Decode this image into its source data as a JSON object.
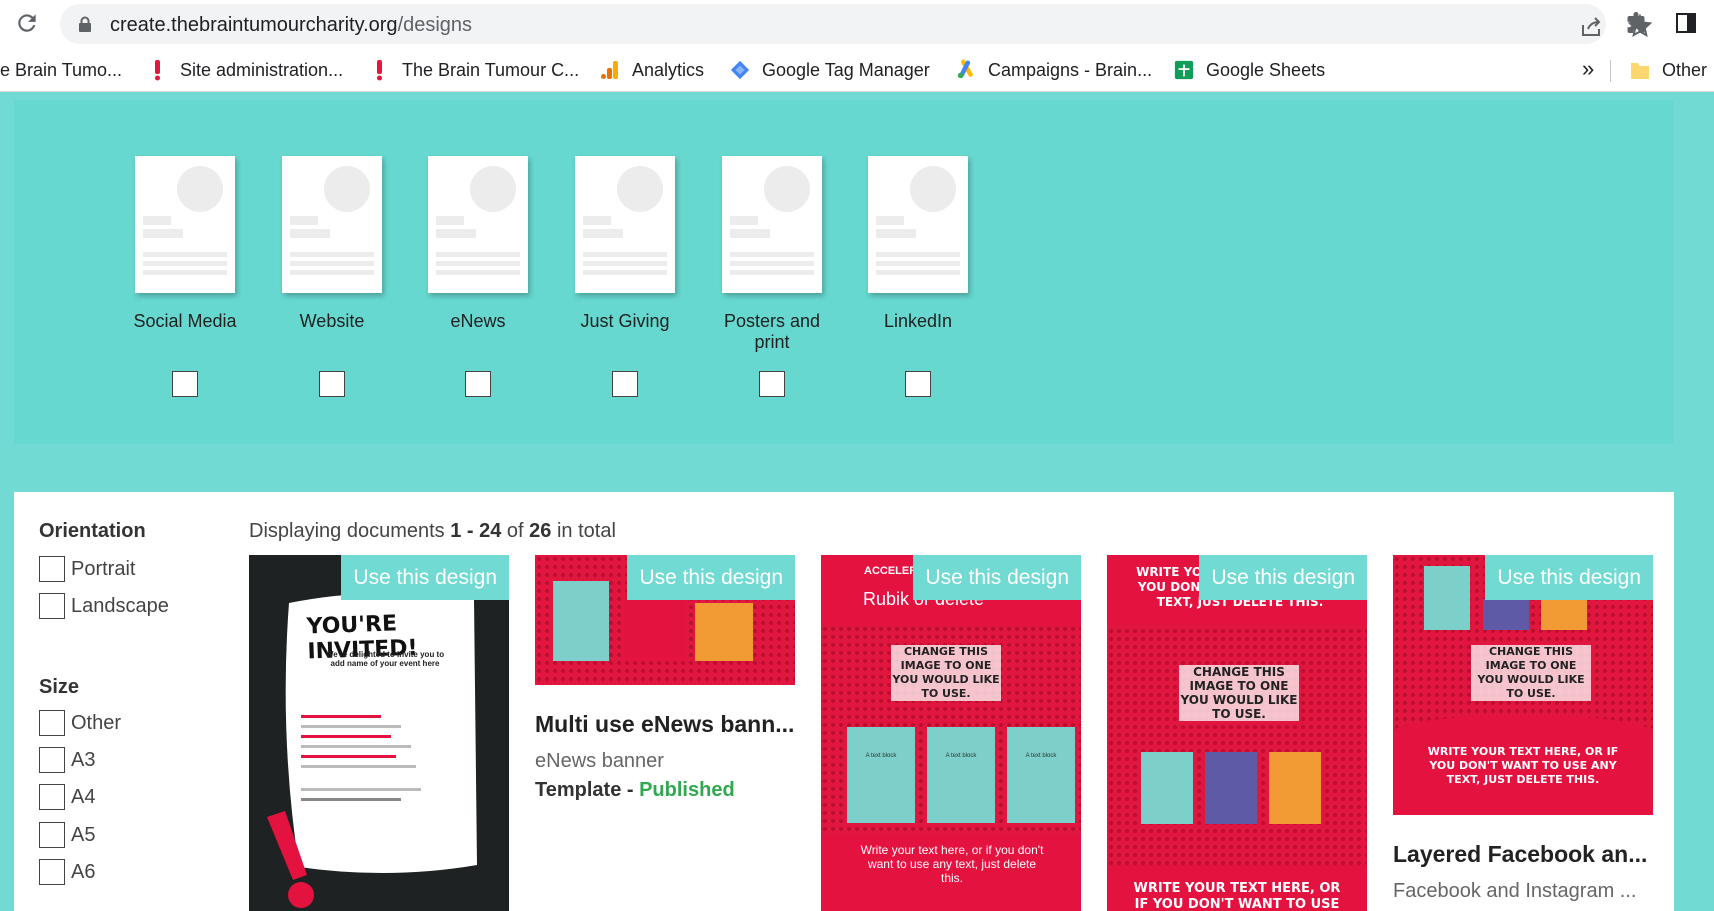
{
  "browser": {
    "url_host": "create.thebraintumourcharity.org",
    "url_path": "/designs",
    "bookmarks": [
      {
        "label": "e Brain Tumo...",
        "icon": "none"
      },
      {
        "label": "Site administration...",
        "icon": "red-exclamation-icon"
      },
      {
        "label": "The Brain Tumour C...",
        "icon": "red-exclamation-icon"
      },
      {
        "label": "Analytics",
        "icon": "analytics-icon"
      },
      {
        "label": "Google Tag Manager",
        "icon": "tag-manager-icon"
      },
      {
        "label": "Campaigns - Brain...",
        "icon": "google-ads-icon"
      },
      {
        "label": "Google Sheets",
        "icon": "sheets-icon"
      }
    ],
    "more": "»",
    "other_label": "Other"
  },
  "types": [
    {
      "label": "Social Media"
    },
    {
      "label": "Website"
    },
    {
      "label": "eNews"
    },
    {
      "label": "Just Giving"
    },
    {
      "label": "Posters and print"
    },
    {
      "label": "LinkedIn"
    }
  ],
  "sidebar": {
    "orientation_heading": "Orientation",
    "orientation_options": [
      "Portrait",
      "Landscape"
    ],
    "size_heading": "Size",
    "size_options": [
      "Other",
      "A3",
      "A4",
      "A5",
      "A6"
    ]
  },
  "results": {
    "prefix": "Displaying documents ",
    "range": "1 - 24",
    "of": " of ",
    "total": "26",
    "suffix": " in total"
  },
  "use_label": "Use this design",
  "cards": [
    {
      "invite_title": "YOU'RE INVITED!",
      "invite_lines": [
        "We're delighted to invite you to",
        "add name of your event here"
      ]
    },
    {
      "title": "Multi use eNews bann...",
      "subtitle": "eNews banner",
      "status_prefix": "Template - ",
      "status": "Published"
    },
    {
      "top_text": "ACCELER",
      "rubik_text": "Rubik or delete",
      "sticker": "CHANGE THIS IMAGE TO ONE YOU WOULD LIKE TO USE.",
      "text_block": "A text block",
      "bottom_text": "Write your text here, or if you don't want to use any text, just delete this."
    },
    {
      "top_text": "WRITE YOUR TEXT HERE, OR IF YOU DON'T WANT TO USE ANY TEXT, JUST DELETE THIS.",
      "sticker": "CHANGE THIS IMAGE TO ONE YOU WOULD LIKE TO USE.",
      "bottom_text": "WRITE YOUR TEXT HERE, OR IF YOU DON'T WANT TO USE ANY"
    },
    {
      "sticker": "CHANGE THIS IMAGE TO ONE YOU WOULD LIKE TO USE.",
      "bottom_text": "WRITE YOUR TEXT HERE, OR IF YOU DON'T WANT TO USE ANY TEXT, JUST DELETE THIS.",
      "title": "Layered Facebook an...",
      "subtitle": "Facebook and Instagram ..."
    }
  ]
}
